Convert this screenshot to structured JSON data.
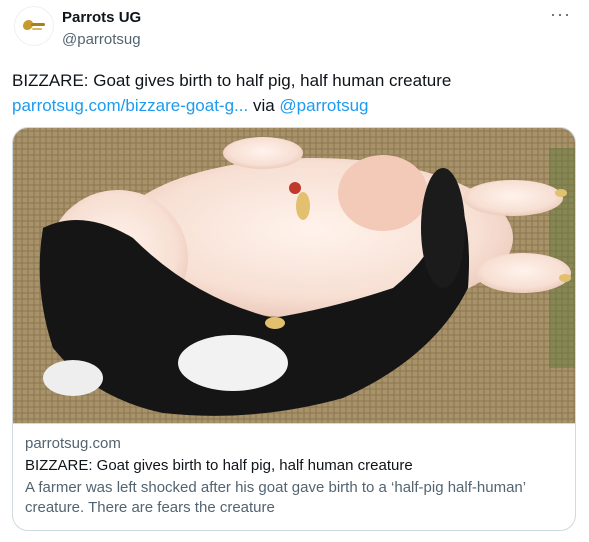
{
  "author": {
    "name": "Parrots UG",
    "handle": "@parrotsug"
  },
  "icons": {
    "more": "more-options-icon"
  },
  "tweet": {
    "text": "BIZZARE: Goat gives birth to half pig, half human creature",
    "link_text": "parrotsug.com/bizzare-goat-g...",
    "via_text": " via ",
    "via_handle": "@parrotsug"
  },
  "card": {
    "domain": "parrotsug.com",
    "title": "BIZZARE: Goat gives birth to half pig, half human creature",
    "description": "A farmer was left shocked after his goat gave birth to a ‘half-pig half-human’ creature. There are fears the creature"
  },
  "colors": {
    "link": "#1d9bf0",
    "secondary_text": "#536471",
    "border": "#cfd9de"
  }
}
